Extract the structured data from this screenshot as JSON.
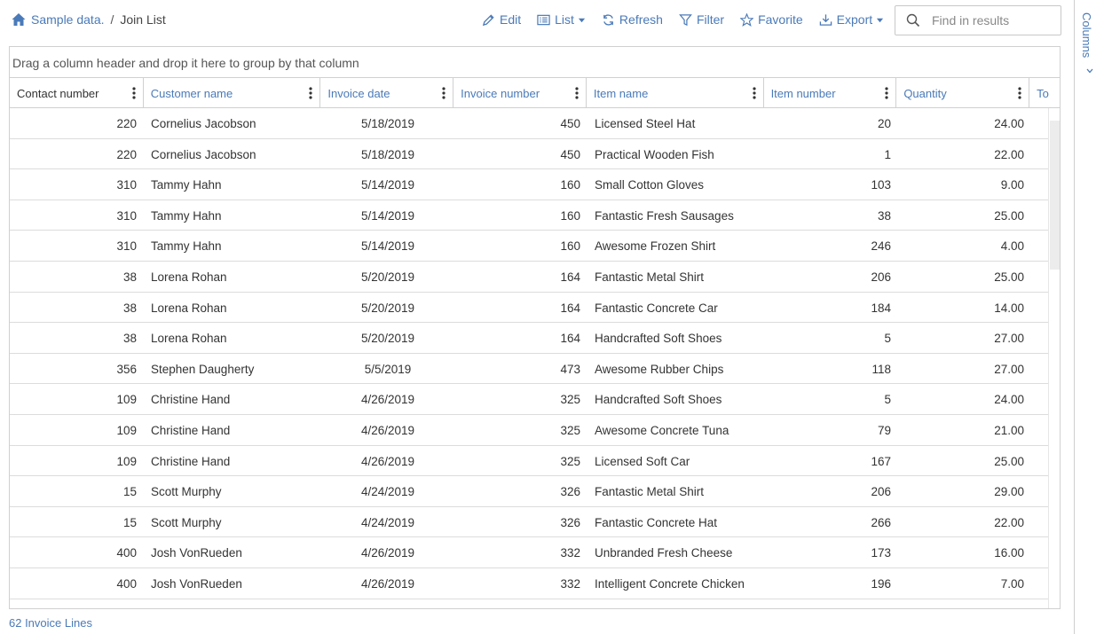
{
  "breadcrumb": {
    "root": "Sample data.",
    "separator": "/",
    "current": "Join List"
  },
  "toolbar": {
    "edit": "Edit",
    "list": "List",
    "refresh": "Refresh",
    "filter": "Filter",
    "favorite": "Favorite",
    "export": "Export"
  },
  "search": {
    "placeholder": "Find in results",
    "value": ""
  },
  "grid": {
    "group_hint": "Drag a column header and drop it here to group by that column",
    "columns": [
      "Contact number",
      "Customer name",
      "Invoice date",
      "Invoice number",
      "Item name",
      "Item number",
      "Quantity",
      "To"
    ],
    "rows": [
      [
        "220",
        "Cornelius Jacobson",
        "5/18/2019",
        "450",
        "Licensed Steel Hat",
        "20",
        "24.00"
      ],
      [
        "220",
        "Cornelius Jacobson",
        "5/18/2019",
        "450",
        "Practical Wooden Fish",
        "1",
        "22.00"
      ],
      [
        "310",
        "Tammy Hahn",
        "5/14/2019",
        "160",
        "Small Cotton Gloves",
        "103",
        "9.00"
      ],
      [
        "310",
        "Tammy Hahn",
        "5/14/2019",
        "160",
        "Fantastic Fresh Sausages",
        "38",
        "25.00"
      ],
      [
        "310",
        "Tammy Hahn",
        "5/14/2019",
        "160",
        "Awesome Frozen Shirt",
        "246",
        "4.00"
      ],
      [
        "38",
        "Lorena Rohan",
        "5/20/2019",
        "164",
        "Fantastic Metal Shirt",
        "206",
        "25.00"
      ],
      [
        "38",
        "Lorena Rohan",
        "5/20/2019",
        "164",
        "Fantastic Concrete Car",
        "184",
        "14.00"
      ],
      [
        "38",
        "Lorena Rohan",
        "5/20/2019",
        "164",
        "Handcrafted Soft Shoes",
        "5",
        "27.00"
      ],
      [
        "356",
        "Stephen Daugherty",
        "5/5/2019",
        "473",
        "Awesome Rubber Chips",
        "118",
        "27.00"
      ],
      [
        "109",
        "Christine Hand",
        "4/26/2019",
        "325",
        "Handcrafted Soft Shoes",
        "5",
        "24.00"
      ],
      [
        "109",
        "Christine Hand",
        "4/26/2019",
        "325",
        "Awesome Concrete Tuna",
        "79",
        "21.00"
      ],
      [
        "109",
        "Christine Hand",
        "4/26/2019",
        "325",
        "Licensed Soft Car",
        "167",
        "25.00"
      ],
      [
        "15",
        "Scott Murphy",
        "4/24/2019",
        "326",
        "Fantastic Metal Shirt",
        "206",
        "29.00"
      ],
      [
        "15",
        "Scott Murphy",
        "4/24/2019",
        "326",
        "Fantastic Concrete Hat",
        "266",
        "22.00"
      ],
      [
        "400",
        "Josh VonRueden",
        "4/26/2019",
        "332",
        "Unbranded Fresh Cheese",
        "173",
        "16.00"
      ],
      [
        "400",
        "Josh VonRueden",
        "4/26/2019",
        "332",
        "Intelligent Concrete Chicken",
        "196",
        "7.00"
      ]
    ]
  },
  "footer": {
    "count_label": "62 Invoice Lines"
  },
  "columns_panel": {
    "label": "Columns"
  },
  "colors": {
    "accent": "#4a7ab8",
    "border": "#d0d0d0",
    "text": "#333333"
  }
}
